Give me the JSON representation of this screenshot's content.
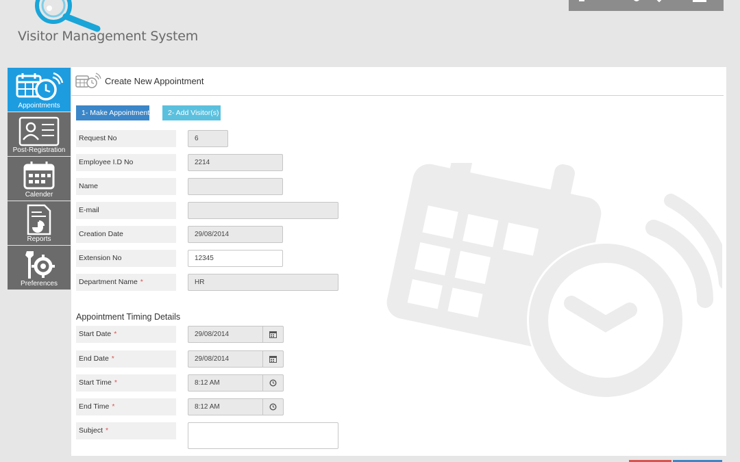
{
  "app": {
    "title": "Visitor Management System"
  },
  "colors": {
    "accent": "#1e9ce0",
    "sidebar_bg": "#6b6b6b",
    "step1": "#3a86c8",
    "step2": "#5bc0de",
    "required": "#d9534f"
  },
  "sidebar": {
    "items": [
      {
        "label": "Appointments",
        "icon": "calendar-clock-icon",
        "active": true
      },
      {
        "label": "Post-Registration",
        "icon": "id-card-icon",
        "active": false
      },
      {
        "label": "Calender",
        "icon": "calendar-icon",
        "active": false
      },
      {
        "label": "Reports",
        "icon": "report-icon",
        "active": false
      },
      {
        "label": "Preferences",
        "icon": "tools-gear-icon",
        "active": false
      }
    ]
  },
  "panel": {
    "title": "Create New Appointment",
    "steps": [
      "1- Make Appointment »",
      "2- Add Visitor(s) »"
    ],
    "fields": {
      "request_no": {
        "label": "Request No",
        "value": "6"
      },
      "employee_id": {
        "label": "Employee I.D No",
        "value": "2214"
      },
      "name": {
        "label": "Name",
        "value": ""
      },
      "email": {
        "label": "E-mail",
        "value": ""
      },
      "creation_date": {
        "label": "Creation Date",
        "value": "29/08/2014"
      },
      "extension_no": {
        "label": "Extension No",
        "value": "12345"
      },
      "department": {
        "label": "Department Name",
        "value": "HR",
        "required": "*"
      }
    },
    "timing": {
      "section_title": "Appointment Timing Details",
      "start_date": {
        "label": "Start Date",
        "value": "29/08/2014",
        "required": "*"
      },
      "end_date": {
        "label": "End Date",
        "value": "29/08/2014",
        "required": "*"
      },
      "start_time": {
        "label": "Start Time",
        "value": "8:12 AM",
        "required": "*"
      },
      "end_time": {
        "label": "End Time",
        "value": "8:12 AM",
        "required": "*"
      },
      "subject": {
        "label": "Subject",
        "value": "",
        "required": "*"
      }
    }
  }
}
